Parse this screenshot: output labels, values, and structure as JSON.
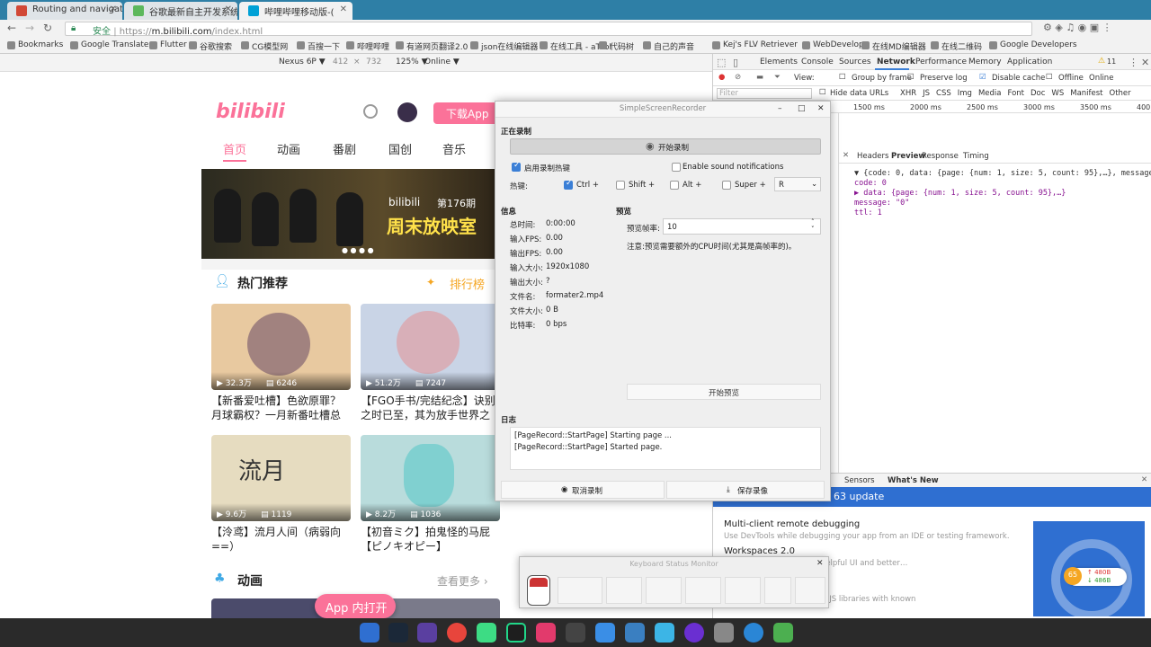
{
  "browser": {
    "tabs": [
      {
        "label": "Routing and navigatio",
        "color": "#d14836"
      },
      {
        "label": "谷歌最新自主开发系统",
        "color": "#5cb85c"
      },
      {
        "label": "哔哩哔哩移动版-(",
        "color": "#00a1d6"
      }
    ],
    "url_secure_label": "安全",
    "url_scheme": "https://",
    "url_host": "m.bilibili.com",
    "url_path": "/index.html",
    "bookmarks": [
      "Bookmarks",
      "Google Translate",
      "Flutter",
      "谷歌搜索",
      "CG模型网",
      "百搜一下",
      "哔哩哔哩",
      "有道网页翻译2.0",
      "json在线编辑器",
      "在线工具 - aTool",
      "代码树",
      "自己的声音",
      "Kej's FLV Retriever",
      "WebDevelop",
      "在线MD编辑器",
      "在线二维码",
      "Google Developers"
    ]
  },
  "device_toolbar": {
    "device": "Nexus 6P ▼",
    "width": "412",
    "x": "×",
    "height": "732",
    "zoom": "125% ▼",
    "network": "Online ▼"
  },
  "bilibili": {
    "logo": "bilibili",
    "download_btn": "下载App",
    "nav": [
      "首页",
      "动画",
      "番剧",
      "国创",
      "音乐"
    ],
    "banner_brand": "bilibili",
    "banner_issue": "第176期",
    "banner_title": "周末放映室",
    "hot_title": "热门推荐",
    "rank_link": "排行榜",
    "cards": [
      {
        "views": "32.3万",
        "danmaku": "6246",
        "title": "【新番爱吐槽】色欲原罪？月球霸权？一月新番吐槽总结！",
        "bg": "#e8c9a0"
      },
      {
        "views": "51.2万",
        "danmaku": "7247",
        "title": "【FGO手书/完结纪念】诀别之时已至，其为放手世界之人",
        "bg": "#c9d4e6"
      },
      {
        "views": "9.6万",
        "danmaku": "1119",
        "title": "【泠鸢】流月人间（病弱向==）",
        "bg": "#e6dcc0"
      },
      {
        "views": "8.2万",
        "danmaku": "1036",
        "title": "【初音ミク】拍鬼怪的马屁【ピノキオピー】",
        "bg": "#b9dcdc"
      }
    ],
    "anim_title": "动画",
    "more_link": "查看更多 ›",
    "open_app": "App 内打开"
  },
  "devtools": {
    "tabs": [
      "Elements",
      "Console",
      "Sources",
      "Network",
      "Performance",
      "Memory",
      "Application"
    ],
    "warning_count": "11",
    "filter_toolbar": {
      "view": "View:",
      "group": "Group by frame",
      "preserve": "Preserve log",
      "disable_cache": "Disable cache",
      "offline": "Offline",
      "online": "Online"
    },
    "filter_placeholder": "Filter",
    "hide_urls": "Hide data URLs",
    "types": [
      "XHR",
      "JS",
      "CSS",
      "Img",
      "Media",
      "Font",
      "Doc",
      "WS",
      "Manifest",
      "Other"
    ],
    "timeline": [
      "1500 ms",
      "2000 ms",
      "2500 ms",
      "3000 ms",
      "3500 ms",
      "400"
    ],
    "detail_tabs": [
      "Headers",
      "Preview",
      "Response",
      "Timing"
    ],
    "json": [
      "▼ {code: 0, data: {page: {num: 1, size: 5, count: 95},…}, message: \"0\",",
      "  code: 0",
      "▶ data: {page: {num: 1, size: 5, count: 95},…}",
      "  message: \"0\"",
      "  ttl: 1"
    ],
    "drawer_tabs": [
      "Sensors",
      "What's New"
    ],
    "whats_new_title": "63 update",
    "news": [
      {
        "title": "Multi-client remote debugging",
        "desc": "Use DevTools while debugging your app from an IDE or testing framework."
      },
      {
        "title": "Workspaces 2.0",
        "desc": "…to disk, now with more helpful UI and better…"
      },
      {
        "title": "",
        "desc": "…ation for images\", \"Avoid JS libraries with known"
      }
    ],
    "badge_count": "65",
    "net_up": "↑ 480B",
    "net_down": "↓ 486B"
  },
  "recorder": {
    "title": "SimpleScreenRecorder",
    "section_recording": "正在录制",
    "start_btn": "开始录制",
    "hotkey_enable": "启用录制热键",
    "sound_notify": "Enable sound notifications",
    "hotkey_label": "热键:",
    "mods": [
      "Ctrl +",
      "Shift +",
      "Alt +",
      "Super +"
    ],
    "key_value": "R",
    "info_title": "信息",
    "info": [
      {
        "k": "总时间:",
        "v": "0:00:00"
      },
      {
        "k": "输入FPS:",
        "v": "0.00"
      },
      {
        "k": "输出FPS:",
        "v": "0.00"
      },
      {
        "k": "输入大小:",
        "v": "1920x1080"
      },
      {
        "k": "输出大小:",
        "v": "?"
      },
      {
        "k": "文件名:",
        "v": "formater2.mp4"
      },
      {
        "k": "文件大小:",
        "v": "0 B"
      },
      {
        "k": "比特率:",
        "v": "0 bps"
      }
    ],
    "preview_title": "预览",
    "preview_fps_label": "预览帧率:",
    "preview_fps": "10",
    "preview_note": "注意:预览需要额外的CPU时间(尤其是高帧率的)。",
    "start_preview": "开始预览",
    "log_title": "日志",
    "log": [
      "[PageRecord::StartPage] Starting page ...",
      "[PageRecord::StartPage] Started page."
    ],
    "cancel_btn": "取消录制",
    "save_btn": "保存录像"
  },
  "keyboard_monitor": {
    "title": "Keyboard Status Monitor"
  }
}
